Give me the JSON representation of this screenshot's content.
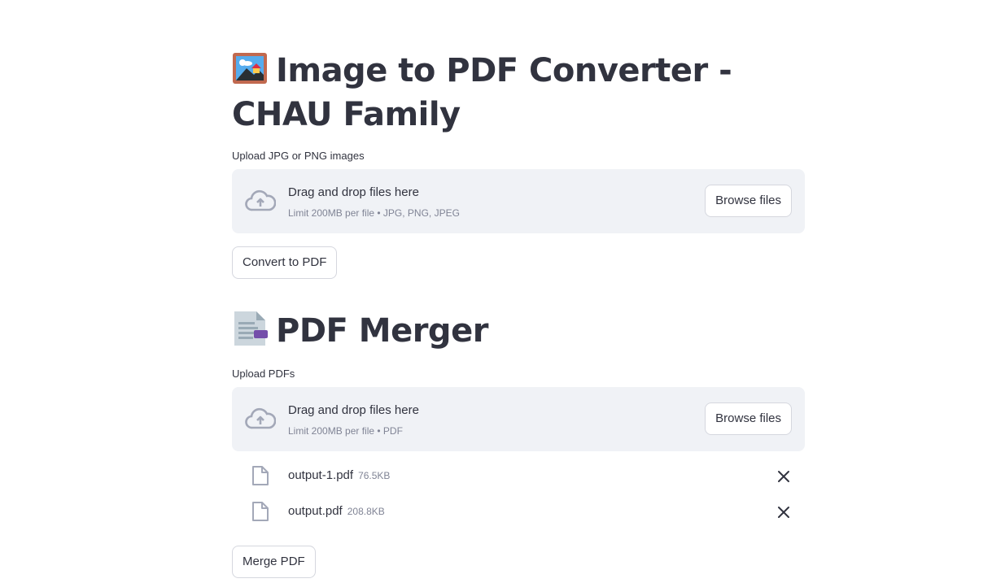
{
  "converter": {
    "title": "Image to PDF Converter - CHAU Family",
    "title_icon": "framed-picture-icon",
    "uploader_label": "Upload JPG or PNG images",
    "dropzone_title": "Drag and drop files here",
    "dropzone_limit": "Limit 200MB per file • JPG, PNG, JPEG",
    "browse_label": "Browse files",
    "convert_label": "Convert to PDF"
  },
  "merger": {
    "title": "PDF Merger",
    "title_icon": "page-facing-up-icon",
    "uploader_label": "Upload PDFs",
    "dropzone_title": "Drag and drop files here",
    "dropzone_limit": "Limit 200MB per file • PDF",
    "browse_label": "Browse files",
    "files": [
      {
        "name": "output-1.pdf",
        "size": "76.5KB"
      },
      {
        "name": "output.pdf",
        "size": "208.8KB"
      }
    ],
    "merge_label": "Merge PDF"
  },
  "colors": {
    "text": "#31333f",
    "muted": "#808495",
    "dropzone_bg": "#f0f2f6",
    "icon": "#a3a8b8"
  }
}
